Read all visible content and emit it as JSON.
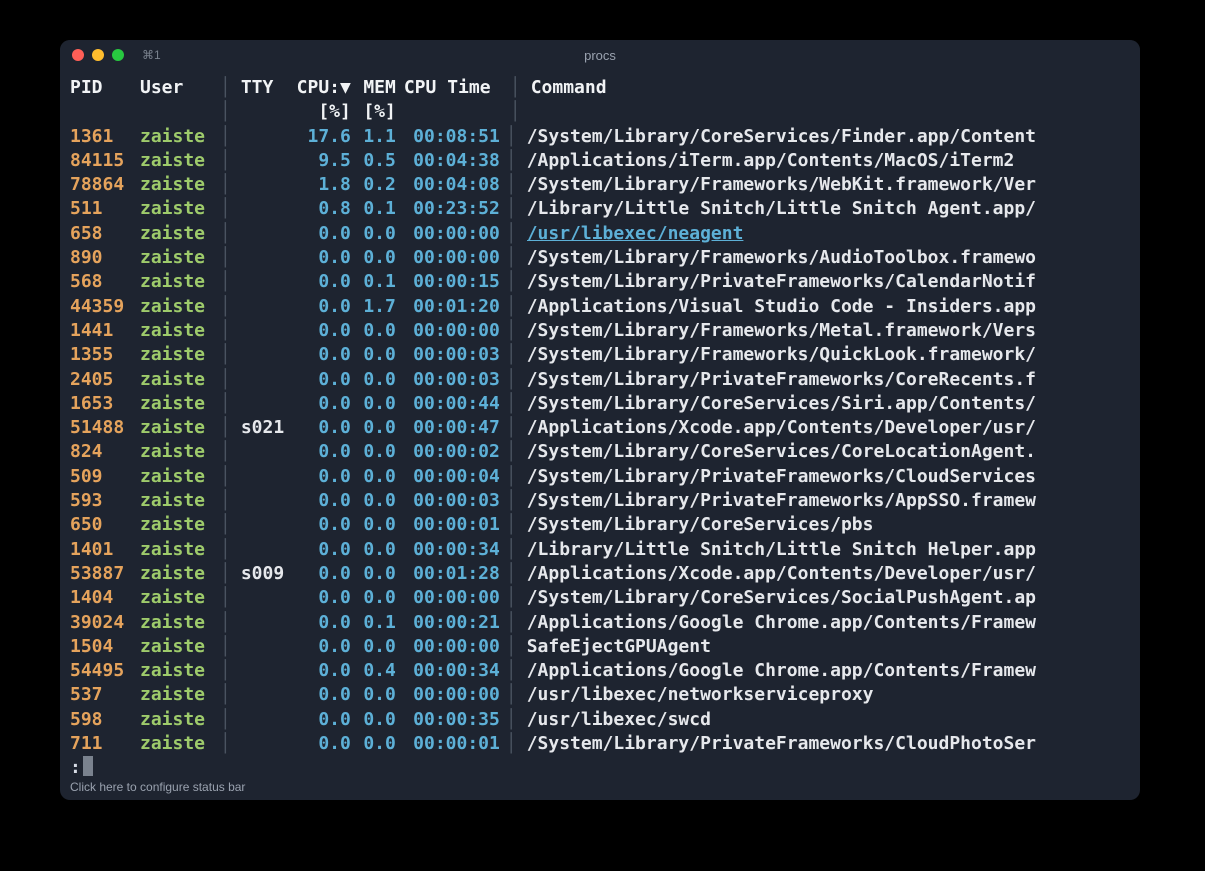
{
  "window": {
    "tab_label": "⌘1",
    "title": "procs"
  },
  "headers": {
    "pid": "PID",
    "user": "User",
    "tty": "TTY",
    "cpu": "CPU:▼",
    "mem": "MEM",
    "time": "CPU Time",
    "cmd": "Command",
    "cpu_unit": "[%]",
    "mem_unit": "[%]"
  },
  "separator": "│",
  "rows": [
    {
      "pid": "1361",
      "user": "zaiste",
      "tty": "",
      "cpu": "17.6",
      "mem": "1.1",
      "time": "00:08:51",
      "cmd": "/System/Library/CoreServices/Finder.app/Content",
      "link": false
    },
    {
      "pid": "84115",
      "user": "zaiste",
      "tty": "",
      "cpu": "9.5",
      "mem": "0.5",
      "time": "00:04:38",
      "cmd": "/Applications/iTerm.app/Contents/MacOS/iTerm2",
      "link": false
    },
    {
      "pid": "78864",
      "user": "zaiste",
      "tty": "",
      "cpu": "1.8",
      "mem": "0.2",
      "time": "00:04:08",
      "cmd": "/System/Library/Frameworks/WebKit.framework/Ver",
      "link": false
    },
    {
      "pid": "511",
      "user": "zaiste",
      "tty": "",
      "cpu": "0.8",
      "mem": "0.1",
      "time": "00:23:52",
      "cmd": "/Library/Little Snitch/Little Snitch Agent.app/",
      "link": false
    },
    {
      "pid": "658",
      "user": "zaiste",
      "tty": "",
      "cpu": "0.0",
      "mem": "0.0",
      "time": "00:00:00",
      "cmd": "/usr/libexec/neagent",
      "link": true
    },
    {
      "pid": "890",
      "user": "zaiste",
      "tty": "",
      "cpu": "0.0",
      "mem": "0.0",
      "time": "00:00:00",
      "cmd": "/System/Library/Frameworks/AudioToolbox.framewo",
      "link": false
    },
    {
      "pid": "568",
      "user": "zaiste",
      "tty": "",
      "cpu": "0.0",
      "mem": "0.1",
      "time": "00:00:15",
      "cmd": "/System/Library/PrivateFrameworks/CalendarNotif",
      "link": false
    },
    {
      "pid": "44359",
      "user": "zaiste",
      "tty": "",
      "cpu": "0.0",
      "mem": "1.7",
      "time": "00:01:20",
      "cmd": "/Applications/Visual Studio Code - Insiders.app",
      "link": false
    },
    {
      "pid": "1441",
      "user": "zaiste",
      "tty": "",
      "cpu": "0.0",
      "mem": "0.0",
      "time": "00:00:00",
      "cmd": "/System/Library/Frameworks/Metal.framework/Vers",
      "link": false
    },
    {
      "pid": "1355",
      "user": "zaiste",
      "tty": "",
      "cpu": "0.0",
      "mem": "0.0",
      "time": "00:00:03",
      "cmd": "/System/Library/Frameworks/QuickLook.framework/",
      "link": false
    },
    {
      "pid": "2405",
      "user": "zaiste",
      "tty": "",
      "cpu": "0.0",
      "mem": "0.0",
      "time": "00:00:03",
      "cmd": "/System/Library/PrivateFrameworks/CoreRecents.f",
      "link": false
    },
    {
      "pid": "1653",
      "user": "zaiste",
      "tty": "",
      "cpu": "0.0",
      "mem": "0.0",
      "time": "00:00:44",
      "cmd": "/System/Library/CoreServices/Siri.app/Contents/",
      "link": false
    },
    {
      "pid": "51488",
      "user": "zaiste",
      "tty": "s021",
      "cpu": "0.0",
      "mem": "0.0",
      "time": "00:00:47",
      "cmd": "/Applications/Xcode.app/Contents/Developer/usr/",
      "link": false
    },
    {
      "pid": "824",
      "user": "zaiste",
      "tty": "",
      "cpu": "0.0",
      "mem": "0.0",
      "time": "00:00:02",
      "cmd": "/System/Library/CoreServices/CoreLocationAgent.",
      "link": false
    },
    {
      "pid": "509",
      "user": "zaiste",
      "tty": "",
      "cpu": "0.0",
      "mem": "0.0",
      "time": "00:00:04",
      "cmd": "/System/Library/PrivateFrameworks/CloudServices",
      "link": false
    },
    {
      "pid": "593",
      "user": "zaiste",
      "tty": "",
      "cpu": "0.0",
      "mem": "0.0",
      "time": "00:00:03",
      "cmd": "/System/Library/PrivateFrameworks/AppSSO.framew",
      "link": false
    },
    {
      "pid": "650",
      "user": "zaiste",
      "tty": "",
      "cpu": "0.0",
      "mem": "0.0",
      "time": "00:00:01",
      "cmd": "/System/Library/CoreServices/pbs",
      "link": false
    },
    {
      "pid": "1401",
      "user": "zaiste",
      "tty": "",
      "cpu": "0.0",
      "mem": "0.0",
      "time": "00:00:34",
      "cmd": "/Library/Little Snitch/Little Snitch Helper.app",
      "link": false
    },
    {
      "pid": "53887",
      "user": "zaiste",
      "tty": "s009",
      "cpu": "0.0",
      "mem": "0.0",
      "time": "00:01:28",
      "cmd": "/Applications/Xcode.app/Contents/Developer/usr/",
      "link": false
    },
    {
      "pid": "1404",
      "user": "zaiste",
      "tty": "",
      "cpu": "0.0",
      "mem": "0.0",
      "time": "00:00:00",
      "cmd": "/System/Library/CoreServices/SocialPushAgent.ap",
      "link": false
    },
    {
      "pid": "39024",
      "user": "zaiste",
      "tty": "",
      "cpu": "0.0",
      "mem": "0.1",
      "time": "00:00:21",
      "cmd": "/Applications/Google Chrome.app/Contents/Framew",
      "link": false
    },
    {
      "pid": "1504",
      "user": "zaiste",
      "tty": "",
      "cpu": "0.0",
      "mem": "0.0",
      "time": "00:00:00",
      "cmd": "SafeEjectGPUAgent",
      "link": false
    },
    {
      "pid": "54495",
      "user": "zaiste",
      "tty": "",
      "cpu": "0.0",
      "mem": "0.4",
      "time": "00:00:34",
      "cmd": "/Applications/Google Chrome.app/Contents/Framew",
      "link": false
    },
    {
      "pid": "537",
      "user": "zaiste",
      "tty": "",
      "cpu": "0.0",
      "mem": "0.0",
      "time": "00:00:00",
      "cmd": "/usr/libexec/networkserviceproxy",
      "link": false
    },
    {
      "pid": "598",
      "user": "zaiste",
      "tty": "",
      "cpu": "0.0",
      "mem": "0.0",
      "time": "00:00:35",
      "cmd": "/usr/libexec/swcd",
      "link": false
    },
    {
      "pid": "711",
      "user": "zaiste",
      "tty": "",
      "cpu": "0.0",
      "mem": "0.0",
      "time": "00:00:01",
      "cmd": "/System/Library/PrivateFrameworks/CloudPhotoSer",
      "link": false
    }
  ],
  "prompt": ":",
  "status_hint": "Click here to configure status bar"
}
